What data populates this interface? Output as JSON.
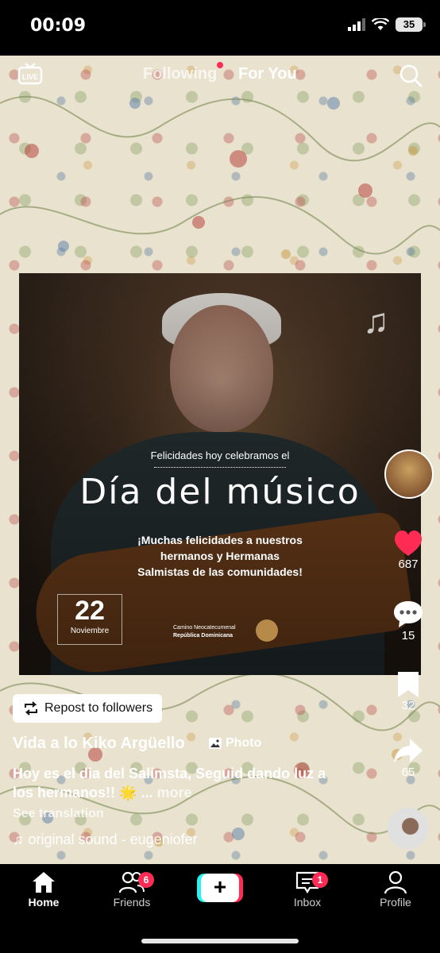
{
  "status_bar": {
    "time": "00:09",
    "battery": "35"
  },
  "top_nav": {
    "following": "Following",
    "for_you": "For You"
  },
  "poster": {
    "subtitle": "Felicidades hoy celebramos el",
    "title": "Día del músico",
    "message_line1": "¡Muchas felicidades a nuestros",
    "message_line2": "hermanos y Hermanas",
    "message_line3": "Salmistas de las comunidades!",
    "date_day": "22",
    "date_month": "Noviembre",
    "org_line1": "Camino Neocatecumenal",
    "org_line2": "República Dominicana"
  },
  "actions": {
    "likes": "687",
    "comments": "15",
    "saves": "32",
    "shares": "65"
  },
  "post": {
    "repost_label": "Repost to followers",
    "author": "Vida a lo Kiko Argüello",
    "photo_tag": "Photo",
    "caption": "Hoy es el dia del Salimsta, Seguid dando luz a los hermanos!! 🌟 ...",
    "more": "more",
    "see_translation": "See translation",
    "sound": "original sound - eugeniofer"
  },
  "bottom_nav": {
    "home": "Home",
    "friends": "Friends",
    "friends_badge": "6",
    "inbox": "Inbox",
    "inbox_badge": "1",
    "profile": "Profile",
    "create": "+"
  },
  "colors": {
    "accent_red": "#fe2c55",
    "accent_cyan": "#25f4ee",
    "background": "#000000"
  }
}
